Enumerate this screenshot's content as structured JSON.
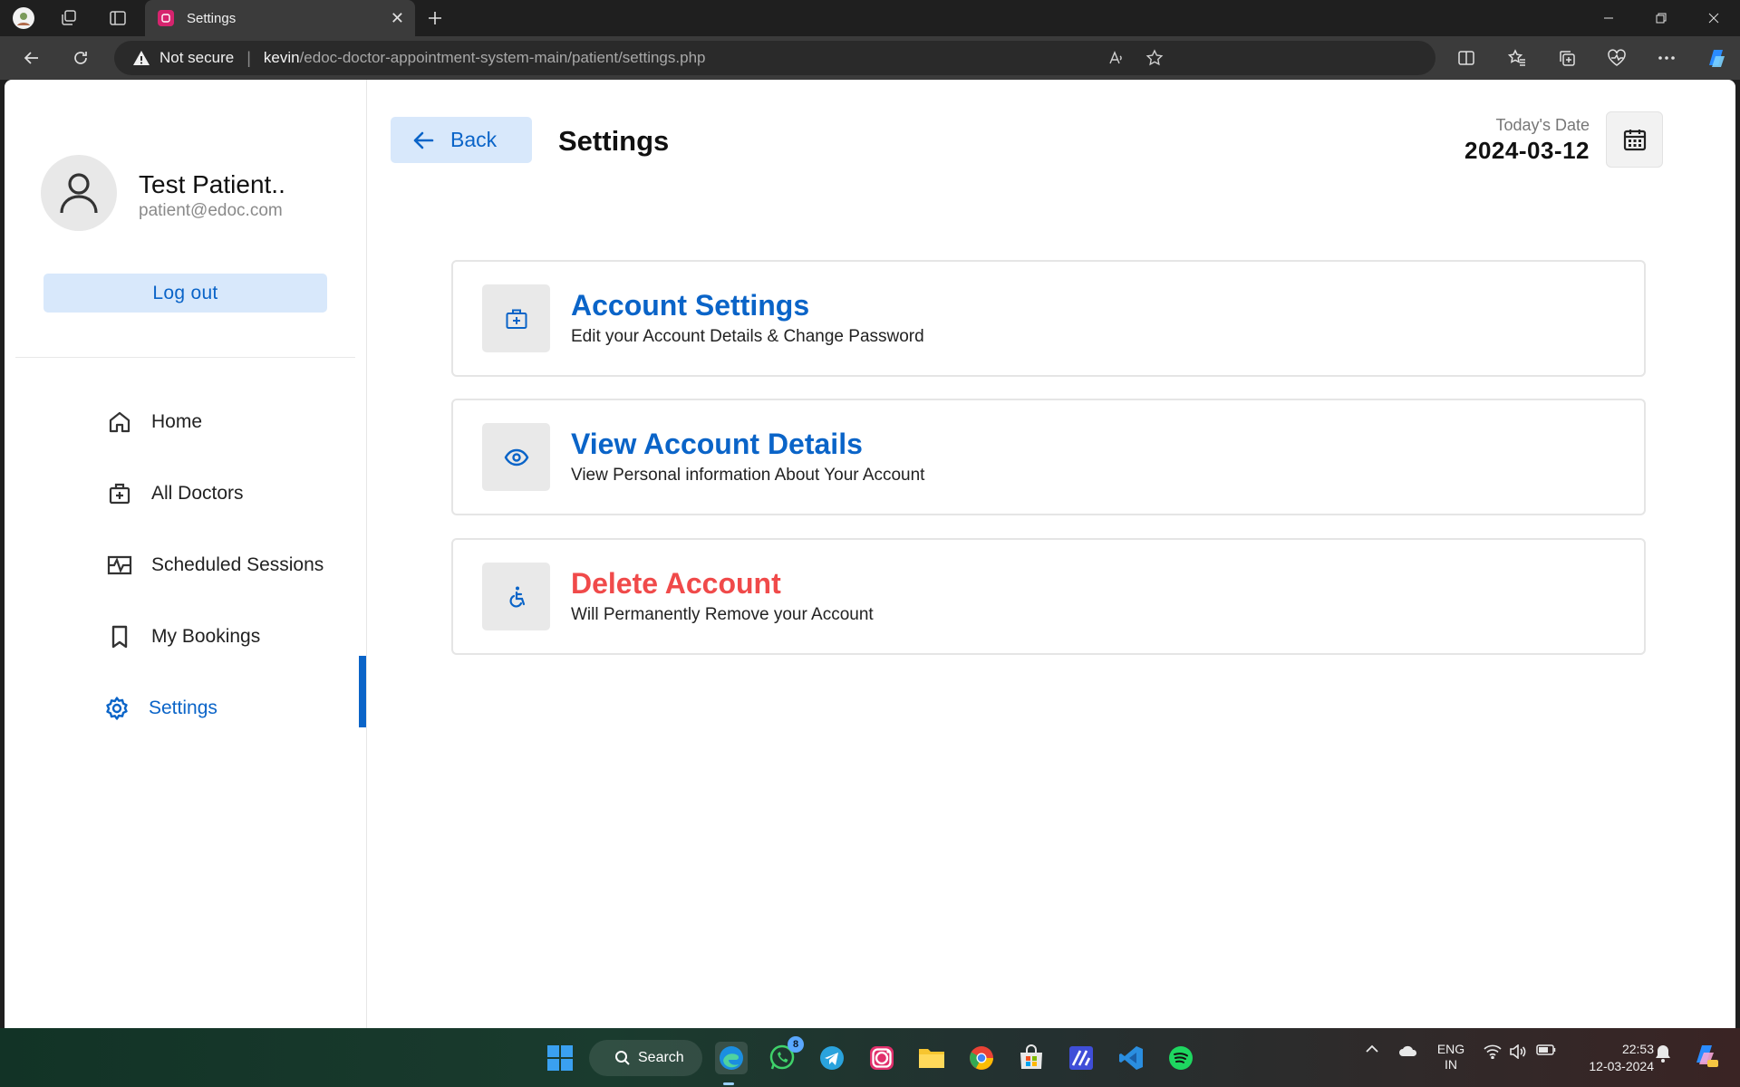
{
  "browser": {
    "tab_title": "Settings",
    "address": {
      "security_label": "Not secure",
      "host": "kevin",
      "path": "/edoc-doctor-appointment-system-main/patient/settings.php"
    }
  },
  "profile": {
    "name": "Test Patient..",
    "email": "patient@edoc.com",
    "logout_label": "Log out"
  },
  "sidebar": {
    "items": [
      {
        "label": "Home",
        "icon": "home-icon"
      },
      {
        "label": "All Doctors",
        "icon": "doctor-bag-icon"
      },
      {
        "label": "Scheduled Sessions",
        "icon": "schedule-icon"
      },
      {
        "label": "My Bookings",
        "icon": "bookmark-icon"
      },
      {
        "label": "Settings",
        "icon": "gear-icon",
        "active": true
      }
    ]
  },
  "header": {
    "back_label": "Back",
    "title": "Settings",
    "date_label": "Today's Date",
    "date_value": "2024-03-12"
  },
  "cards": [
    {
      "title": "Account Settings",
      "subtitle": "Edit your Account Details & Change Password",
      "icon": "medical-kit-icon"
    },
    {
      "title": "View Account Details",
      "subtitle": "View Personal information About Your Account",
      "icon": "eye-icon"
    },
    {
      "title": "Delete Account",
      "subtitle": "Will Permanently Remove your Account",
      "icon": "accessibility-icon",
      "danger": true
    }
  ],
  "taskbar": {
    "search_label": "Search",
    "whatsapp_badge": "8",
    "lang_line1": "ENG",
    "lang_line2": "IN",
    "time": "22:53",
    "date": "12-03-2024"
  },
  "colors": {
    "accent": "#0a64c8",
    "accent_light": "#d8e8fb",
    "danger": "#f04a4a"
  }
}
